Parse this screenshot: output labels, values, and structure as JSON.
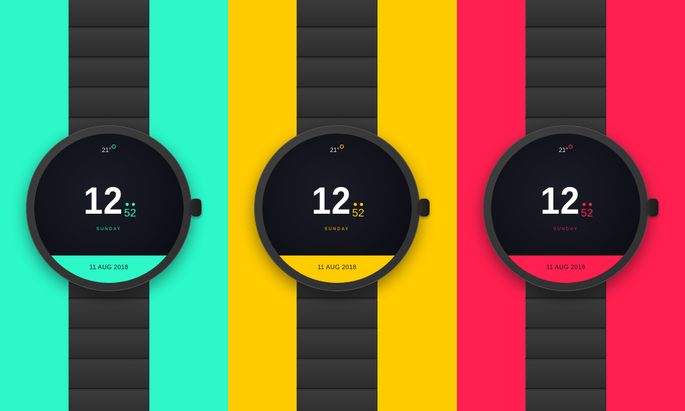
{
  "watches": [
    {
      "background": "#2cf8c8",
      "accent": "#2cf8c8",
      "temperature": "21°",
      "hour": "12",
      "minute": "52",
      "day": "SUNDAY",
      "date": "11 AUG 2018"
    },
    {
      "background": "#ffcc00",
      "accent": "#ffcc00",
      "temperature": "21°",
      "hour": "12",
      "minute": "52",
      "day": "SUNDAY",
      "date": "11 AUG 2018"
    },
    {
      "background": "#ff2050",
      "accent": "#ff2050",
      "temperature": "21°",
      "hour": "12",
      "minute": "52",
      "day": "SUNDAY",
      "date": "11 AUG 2018"
    }
  ],
  "colors": {
    "strap": "#343434",
    "face": "#0e0f16"
  }
}
